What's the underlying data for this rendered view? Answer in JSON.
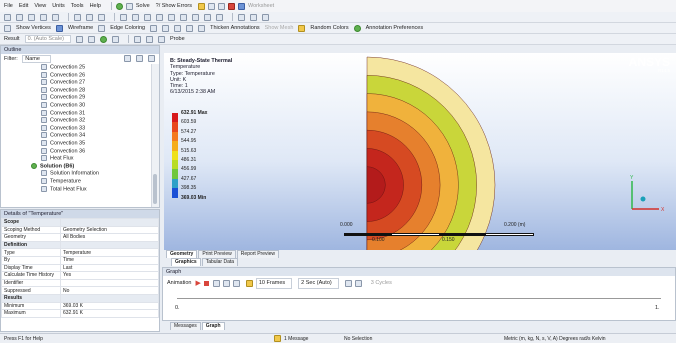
{
  "menu": [
    "File",
    "Edit",
    "View",
    "Units",
    "Tools",
    "Help"
  ],
  "toolbar1": {
    "solve": "Solve",
    "show_errors": "?/ Show Errors",
    "worksheet": "Worksheet"
  },
  "toolbar3": {
    "show_vertices": "Show Vertices",
    "wireframe": "Wireframe",
    "edge_coloring": "Edge Coloring",
    "thicken": "Thicken Annotations",
    "show_mesh": "Show Mesh",
    "random_colors": "Random Colors",
    "annotation_prefs": "Annotation Preferences"
  },
  "toolbar4": {
    "result_label": "Result",
    "result_value": "0. (Auto Scale)",
    "probe": "Probe"
  },
  "outline": {
    "title": "Outline",
    "filter_label": "Filter:",
    "filter_value": "Name",
    "items": [
      {
        "label": "Convection 25",
        "level": 3
      },
      {
        "label": "Convection 26",
        "level": 3
      },
      {
        "label": "Convection 27",
        "level": 3
      },
      {
        "label": "Convection 28",
        "level": 3
      },
      {
        "label": "Convection 29",
        "level": 3
      },
      {
        "label": "Convection 30",
        "level": 3
      },
      {
        "label": "Convection 31",
        "level": 3
      },
      {
        "label": "Convection 32",
        "level": 3
      },
      {
        "label": "Convection 33",
        "level": 3
      },
      {
        "label": "Convection 34",
        "level": 3
      },
      {
        "label": "Convection 35",
        "level": 3
      },
      {
        "label": "Convection 36",
        "level": 3
      },
      {
        "label": "Heat Flux",
        "level": 3
      },
      {
        "label": "Solution (B6)",
        "level": 2
      },
      {
        "label": "Solution Information",
        "level": 3
      },
      {
        "label": "Temperature",
        "level": 3
      },
      {
        "label": "Total Heat Flux",
        "level": 3
      }
    ]
  },
  "details": {
    "title": "Details of \"Temperature\"",
    "rows": [
      {
        "section": true,
        "key": "Scope",
        "value": ""
      },
      {
        "key": "Scoping Method",
        "value": "Geometry Selection"
      },
      {
        "key": "Geometry",
        "value": "All Bodies"
      },
      {
        "section": true,
        "key": "Definition",
        "value": ""
      },
      {
        "key": "Type",
        "value": "Temperature"
      },
      {
        "key": "By",
        "value": "Time"
      },
      {
        "key": "Display Time",
        "value": "Last"
      },
      {
        "key": "Calculate Time History",
        "value": "Yes"
      },
      {
        "key": "Identifier",
        "value": ""
      },
      {
        "key": "Suppressed",
        "value": "No"
      },
      {
        "section": true,
        "key": "Results",
        "value": ""
      },
      {
        "key": "Minimum",
        "value": "369.03 K"
      },
      {
        "key": "Maximum",
        "value": "632.91 K"
      }
    ]
  },
  "viewport": {
    "header": [
      "B: Steady-State Thermal",
      "Temperature",
      "Type: Temperature",
      "Unit: K",
      "Time: 1",
      "6/13/2015 2:38 AM"
    ],
    "max_label": "632.91 Max",
    "min_label": "369.03 Min",
    "legend": [
      "603.59",
      "574.27",
      "544.95",
      "515.63",
      "486.31",
      "456.99",
      "427.67",
      "398.35"
    ],
    "legend_colors": [
      "#d7191c",
      "#e8471d",
      "#f47a1f",
      "#f5ad1b",
      "#efe11c",
      "#b8dc25",
      "#6fc73e",
      "#2ea0c8",
      "#1a4fd6"
    ],
    "brand": "ANSYS",
    "version": "R14.5",
    "scale_labels": [
      "0.000",
      "0.100",
      "0.150",
      "0.200 (m)"
    ],
    "ring_colors": [
      "#f5e6a0",
      "#c9d63a",
      "#f0b23c",
      "#e6802d",
      "#d64a22",
      "#c4261d",
      "#b31b1b"
    ]
  },
  "view_tabs": [
    "Geometry",
    "Print Preview",
    "Report Preview"
  ],
  "subtabs": [
    "Graphics",
    "Tabular Data"
  ],
  "graph": {
    "title": "Graph",
    "animation": "Animation",
    "frames": "10 Frames",
    "duration": "2 Sec (Auto)",
    "cycles": "3 Cycles",
    "axis_start": "0.",
    "axis_end": "1."
  },
  "bottom_tabs": [
    "Messages",
    "Graph"
  ],
  "status": {
    "help": "Press F1 for Help",
    "messages": "1 Message",
    "selection": "No Selection",
    "units": "Metric (m, kg, N, s, V, A)  Degrees  rad/s  Kelvin"
  }
}
